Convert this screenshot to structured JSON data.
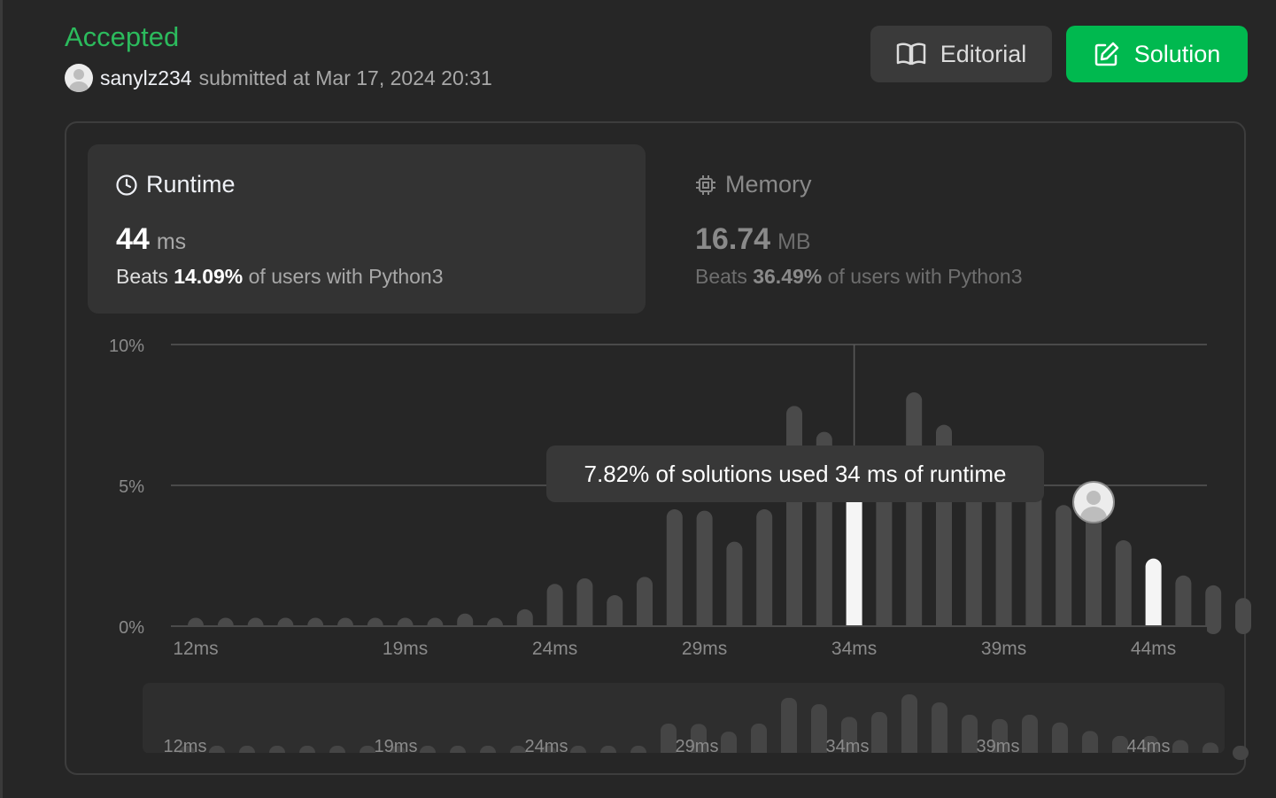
{
  "header": {
    "status": "Accepted",
    "username": "sanylz234",
    "submitted_text": "submitted at Mar 17, 2024 20:31",
    "editorial_label": "Editorial",
    "solution_label": "Solution"
  },
  "runtime": {
    "title": "Runtime",
    "value": "44",
    "unit": "ms",
    "beats_prefix": "Beats",
    "beats_pct": "14.09%",
    "beats_suffix": "of users with Python3"
  },
  "memory": {
    "title": "Memory",
    "value": "16.74",
    "unit": "MB",
    "beats_prefix": "Beats",
    "beats_pct": "36.49%",
    "beats_suffix": "of users with Python3"
  },
  "tooltip": "7.82% of solutions used 34 ms of runtime",
  "colors": {
    "accepted": "#2cbb5d",
    "solution_button": "#00b94f",
    "bar": "#4a4a4a",
    "bar_highlight": "#f5f5f5"
  },
  "chart_data": {
    "type": "bar",
    "title": "",
    "xlabel": "",
    "ylabel": "",
    "ylim": [
      0,
      10
    ],
    "y_ticks": [
      "10%",
      "5%",
      "0%"
    ],
    "x_tick_labels": [
      "12ms",
      "19ms",
      "24ms",
      "29ms",
      "34ms",
      "39ms",
      "44ms"
    ],
    "categories": [
      "12",
      "13",
      "14",
      "15",
      "16",
      "17",
      "18",
      "19",
      "20",
      "21",
      "22",
      "23",
      "24",
      "25",
      "26",
      "27",
      "28",
      "29",
      "30",
      "31",
      "32",
      "33",
      "34",
      "35",
      "36",
      "37",
      "38",
      "39",
      "40",
      "41",
      "42",
      "43",
      "44",
      "45",
      "46",
      "47"
    ],
    "values": [
      0.3,
      0.3,
      0.3,
      0.3,
      0.3,
      0.3,
      0.3,
      0.3,
      0.3,
      0.45,
      0.3,
      0.6,
      1.5,
      1.7,
      1.1,
      1.75,
      4.15,
      4.1,
      3.0,
      4.15,
      7.82,
      6.9,
      6.4,
      6.1,
      8.3,
      7.15,
      6.0,
      5.4,
      5.1,
      4.3,
      4.3,
      3.05,
      2.4,
      1.8,
      1.45,
      1.0
    ],
    "highlighted": [
      "34",
      "44"
    ],
    "mini_values": [
      0.3,
      0.3,
      0.3,
      0.3,
      0.3,
      0.3,
      0.3,
      0.3,
      0.3,
      0.3,
      0.3,
      0.3,
      0.3,
      0.3,
      0.3,
      0.3,
      4.15,
      4.1,
      3.0,
      4.15,
      7.82,
      6.9,
      5.1,
      5.8,
      8.3,
      7.15,
      5.4,
      4.8,
      5.4,
      4.3,
      3.1,
      2.4,
      2.4,
      1.8,
      1.45,
      1.0
    ]
  }
}
